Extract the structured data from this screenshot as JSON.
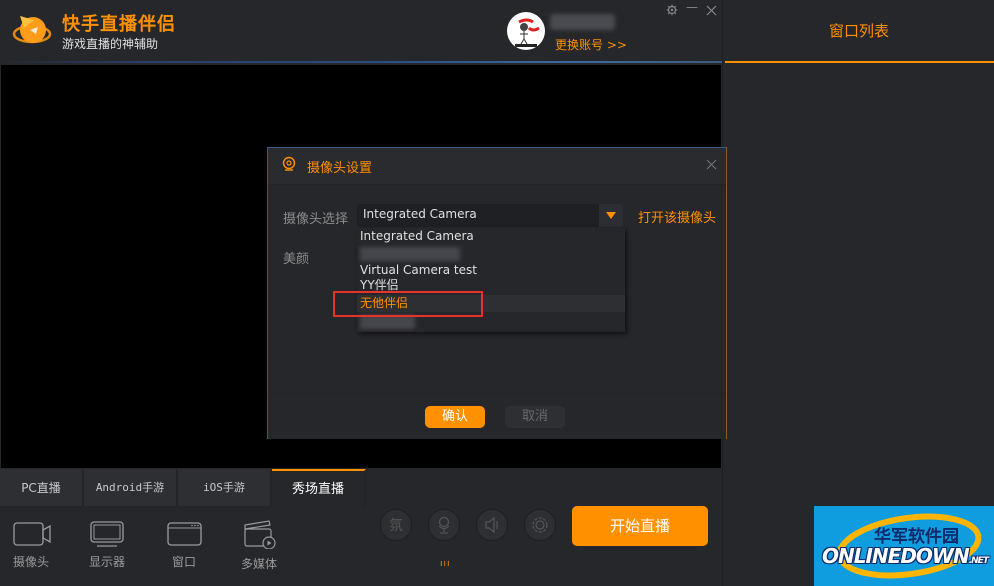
{
  "app": {
    "title": "快手直播伴侣",
    "subtitle": "游戏直播的神辅助",
    "switch_account": "更换账号 >>",
    "accent_color": "#ff9000"
  },
  "window_controls": {
    "settings_icon": "gear-icon",
    "minimize": "—",
    "close": "✕"
  },
  "right_panel": {
    "tab_label": "窗口列表"
  },
  "dialog": {
    "title": "摄像头设置",
    "camera_label": "摄像头选择",
    "selected_camera": "Integrated Camera",
    "open_camera_link": "打开该摄像头",
    "beauty_label": "美颜",
    "options": [
      {
        "label": "Integrated Camera"
      },
      {
        "label": ""
      },
      {
        "label": "Virtual Camera test"
      },
      {
        "label": "YY伴侣"
      },
      {
        "label": "无他伴侣",
        "highlighted": true
      },
      {
        "label": ""
      }
    ],
    "confirm": "确认",
    "cancel": "取消"
  },
  "bottom_tabs": [
    {
      "label": "PC直播"
    },
    {
      "label": "Android手游"
    },
    {
      "label": "iOS手游"
    },
    {
      "label": "秀场直播",
      "active": true
    }
  ],
  "sources": [
    {
      "label": "摄像头",
      "icon": "camera-icon"
    },
    {
      "label": "显示器",
      "icon": "monitor-icon"
    },
    {
      "label": "窗口",
      "icon": "window-icon"
    },
    {
      "label": "多媒体",
      "icon": "media-icon"
    }
  ],
  "controls": {
    "atmosphere": "氛",
    "mic_level": "ııı",
    "start_live": "开始直播"
  },
  "watermark": {
    "cn": "华军软件园",
    "en": "ONLINEDOWN",
    "net": ".NET"
  }
}
